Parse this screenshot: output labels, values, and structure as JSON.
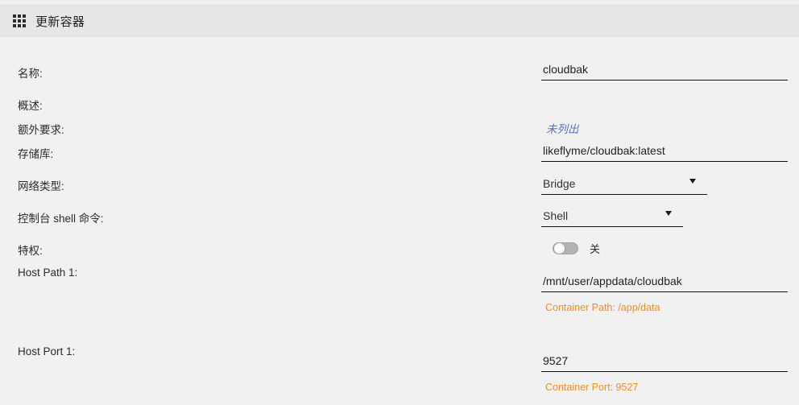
{
  "window": {
    "title": "更新容器",
    "menu_icon": "grid-apps-icon"
  },
  "theme": {
    "page_background": "#f1f1f1",
    "titlebar_background": "#e6e6e6",
    "text": "#2b2b2b",
    "link_accent": "#5b6fc0",
    "helper_accent": "#e8922a",
    "underline": "#111111"
  },
  "form": {
    "name": {
      "label": "名称:",
      "value": "cloudbak",
      "placeholder": ""
    },
    "overview": {
      "label": "概述:"
    },
    "extra_requirements": {
      "label": "额外要求:",
      "value": "未列出"
    },
    "repository": {
      "label": "存储库:",
      "value": "likeflyme/cloudbak:latest",
      "placeholder": ""
    },
    "network_type": {
      "label": "网络类型:",
      "selected": "Bridge",
      "caret": "chevron-down-icon"
    },
    "console_shell_command": {
      "label": "控制台 shell 命令:",
      "selected": "Shell",
      "caret": "chevron-down-icon"
    },
    "privileged": {
      "label": "特权:",
      "state_label": "关",
      "on": false
    },
    "host_path_1": {
      "label": "Host Path 1:",
      "value": "/mnt/user/appdata/cloudbak",
      "helper": "Container Path: /app/data"
    },
    "host_port_1": {
      "label": "Host Port 1:",
      "value": "9527",
      "helper": "Container Port: 9527"
    }
  }
}
